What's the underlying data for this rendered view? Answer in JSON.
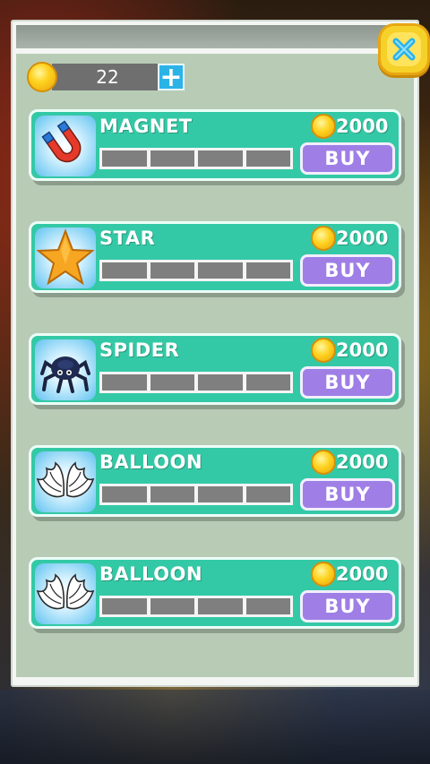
{
  "wallet": {
    "coins": "22",
    "add_label": "+"
  },
  "close": {
    "label": "✕"
  },
  "items": [
    {
      "name": "MAGNET",
      "price": "2000",
      "buy_label": "BUY",
      "level": 0,
      "levels_total": 4,
      "icon": "magnet-icon"
    },
    {
      "name": "STAR",
      "price": "2000",
      "buy_label": "BUY",
      "level": 0,
      "levels_total": 4,
      "icon": "star-icon"
    },
    {
      "name": "SPIDER",
      "price": "2000",
      "buy_label": "BUY",
      "level": 0,
      "levels_total": 4,
      "icon": "spider-icon"
    },
    {
      "name": "BALLOON",
      "price": "2000",
      "buy_label": "BUY",
      "level": 0,
      "levels_total": 4,
      "icon": "wings-icon"
    },
    {
      "name": "BALLOON",
      "price": "2000",
      "buy_label": "BUY",
      "level": 0,
      "levels_total": 4,
      "icon": "wings-icon"
    }
  ],
  "colors": {
    "card": "#34c9a6",
    "buy": "#9f7fe6",
    "coin": "#ffd21e",
    "close": "#f6d12a"
  }
}
